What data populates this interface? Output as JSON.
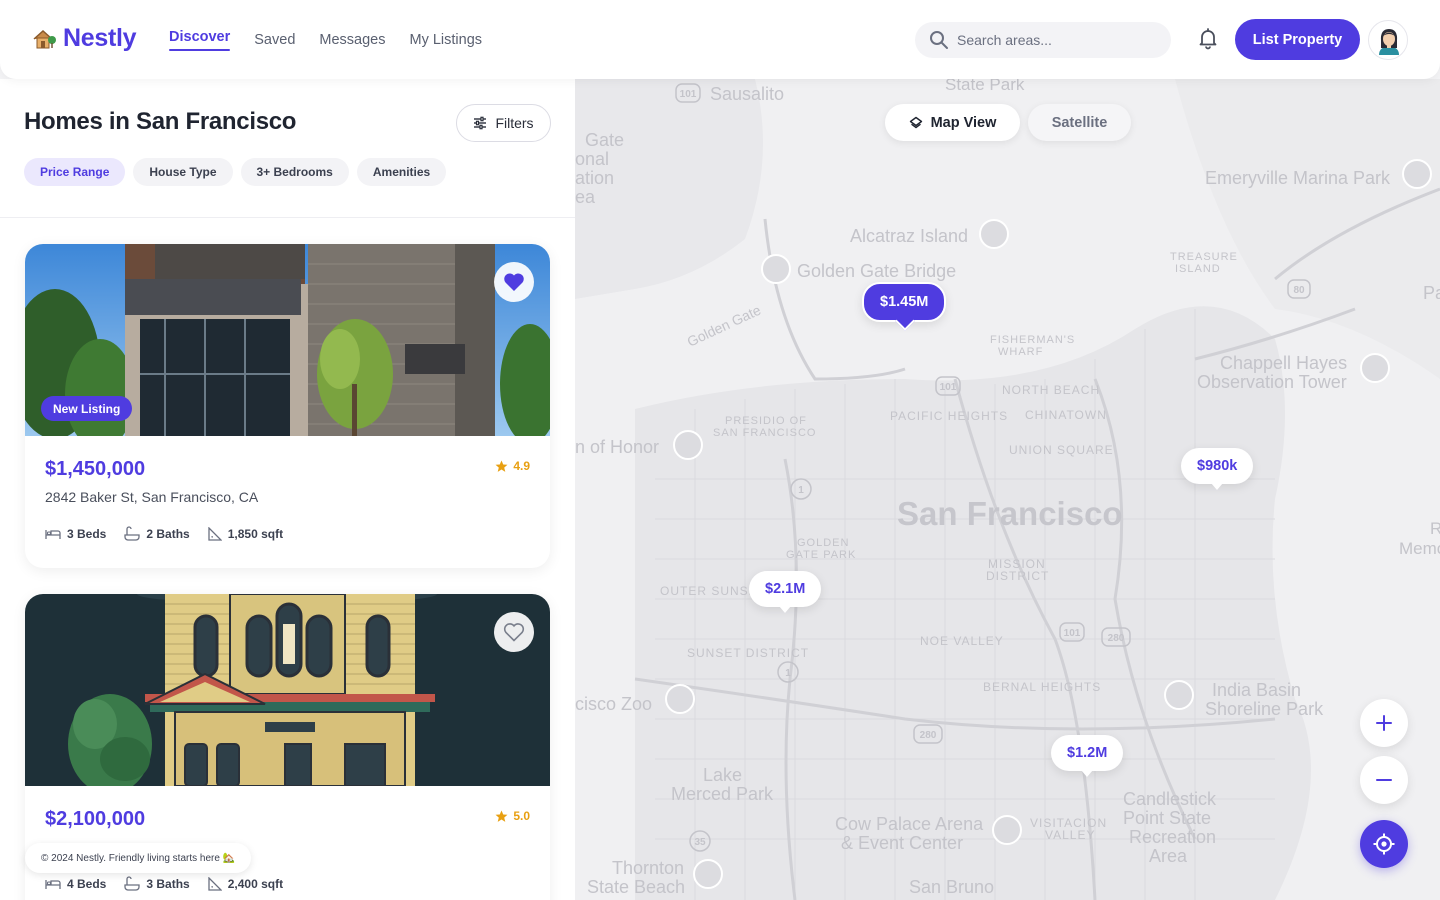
{
  "brand": {
    "name": "Nestly",
    "accent": "#4f3ce0"
  },
  "nav": [
    {
      "label": "Discover",
      "active": true
    },
    {
      "label": "Saved"
    },
    {
      "label": "Messages"
    },
    {
      "label": "My Listings"
    }
  ],
  "search": {
    "placeholder": "Search areas...",
    "value": ""
  },
  "header": {
    "list_button": "List Property"
  },
  "panel": {
    "title": "Homes in San Francisco",
    "filters_label": "Filters",
    "chips": [
      {
        "label": "Price Range",
        "active": true
      },
      {
        "label": "House Type"
      },
      {
        "label": "3+ Bedrooms"
      },
      {
        "label": "Amenities"
      }
    ]
  },
  "listings": [
    {
      "price": "$1,450,000",
      "rating": "4.9",
      "address": "2842 Baker St, San Francisco, CA",
      "badge": "New Listing",
      "favorited": true,
      "beds": "3 Beds",
      "baths": "2 Baths",
      "sqft": "1,850 sqft"
    },
    {
      "price": "$2,100,000",
      "rating": "5.0",
      "address": "",
      "favorited": false,
      "beds": "4 Beds",
      "baths": "3 Baths",
      "sqft": "2,400 sqft"
    }
  ],
  "footer_note": "© 2024 Nestly. Friendly living starts here 🏡",
  "map": {
    "view_toggle": {
      "map": "Map View",
      "satellite": "Satellite",
      "selected": "map"
    },
    "pins": [
      {
        "label": "$1.45M",
        "active": true
      },
      {
        "label": "$980k"
      },
      {
        "label": "$2.1M"
      },
      {
        "label": "$1.2M"
      }
    ],
    "labels": {
      "city": "San Francisco",
      "sausalito": "Sausalito",
      "alcatraz": "Alcatraz Island",
      "ggb": "Golden Gate Bridge",
      "golden_gate": "Golden Gate",
      "emeryville": "Emeryville Marina Park",
      "treasure1": "TREASURE",
      "treasure2": "ISLAND",
      "fisherman1": "FISHERMAN'S",
      "fisherman2": "WHARF",
      "north_beach": "NORTH BEACH",
      "chinatown": "CHINATOWN",
      "pacific_heights": "PACIFIC HEIGHTS",
      "presidio1": "PRESIDIO OF",
      "presidio2": "SAN FRANCISCO",
      "union_square": "UNION SQUARE",
      "chappell1": "Chappell Hayes",
      "chappell2": "Observation Tower",
      "legion": "n of Honor",
      "gg_park1": "GOLDEN",
      "gg_park2": "GATE PARK",
      "outer_sunset": "OUTER SUNSE",
      "mission1": "MISSION",
      "mission2": "DISTRICT",
      "noe_valley": "NOE VALLEY",
      "sunset": "SUNSET DISTRICT",
      "bernal": "BERNAL HEIGHTS",
      "zoo": "cisco Zoo",
      "india1": "India Basin",
      "india2": "Shoreline Park",
      "lake1": "Lake",
      "lake2": "Merced Park",
      "candlestick1": "Candlestick",
      "candlestick2": "Point State",
      "candlestick3": "Recreation",
      "candlestick4": "Area",
      "cow1": "Cow Palace Arena",
      "cow2": "& Event Center",
      "visitacion1": "VISITACION",
      "visitacion2": "VALLEY",
      "thornton1": "Thornton",
      "thornton2": "State Beach",
      "san_bruno": "San Bruno",
      "gate_partial1": "Gate",
      "gate_partial2": "onal",
      "gate_partial3": "ation",
      "gate_partial4": "ea",
      "pac": "Paci",
      "memo1": "R",
      "memo2": "Memo",
      "state_park": "State Park",
      "r101a": "101",
      "r101b": "101",
      "r101c": "101",
      "r280a": "280",
      "r280b": "280",
      "r1a": "1",
      "r1b": "1",
      "r35": "35",
      "r80": "80"
    }
  }
}
